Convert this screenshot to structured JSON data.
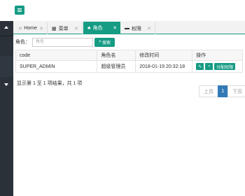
{
  "colors": {
    "accent": "#169b84",
    "sidebar": "#2a3139",
    "page_active": "#337ab7"
  },
  "tabs": [
    {
      "label": "Home",
      "icon": "home-icon",
      "active": false
    },
    {
      "label": "菜单",
      "icon": "grid-icon",
      "active": false
    },
    {
      "label": "角色",
      "icon": "users-icon",
      "active": true
    },
    {
      "label": "权限",
      "icon": "card-icon",
      "active": false
    }
  ],
  "search": {
    "label": "角色：",
    "placeholder": "角色",
    "button_label": "搜索"
  },
  "table": {
    "columns": [
      "code",
      "角色名",
      "修改时间",
      "操作"
    ],
    "rows": [
      {
        "code": "SUPER_ADMIN",
        "name": "超级管理员",
        "modified": "2018-01-19 20:32:18",
        "assign_label": "分配权限"
      }
    ]
  },
  "summary": "显示第 1 至 1 项结果，共 1 项",
  "pagination": {
    "prev": "上页",
    "current": "1",
    "next": "下页"
  }
}
